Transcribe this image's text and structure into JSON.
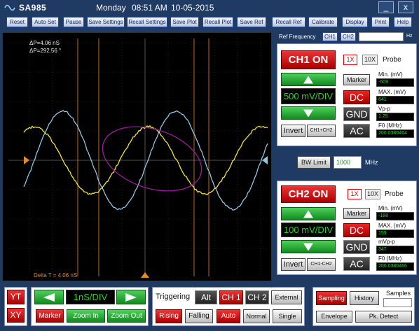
{
  "titlebar": {
    "app_name": "SA985",
    "day": "Monday",
    "time": "08:51 AM",
    "date": "10-05-2015",
    "minimize": "_",
    "close": "x"
  },
  "toolbar": {
    "buttons": [
      "Reset",
      "Auto Set",
      "Pause",
      "Save Settings",
      "Recall Settings",
      "Save Plot",
      "Recall Plot",
      "Save Ref",
      "Recall Ref",
      "Calibrate",
      "Display",
      "Print",
      "Help"
    ]
  },
  "scope": {
    "delta_p1": "ΔP=4.06  nS",
    "delta_p2": "ΔP=292.56 °",
    "delta_t": "Delta T = 4.06 nS",
    "colors": {
      "ch1": "#f5e23a",
      "ch2": "#8fc7e8",
      "xy": "#9b1c9b",
      "cursor": "#e08a2c",
      "grid": "#3a3a3a"
    }
  },
  "ref": {
    "label": "Ref Frequency",
    "ch1": "CH1",
    "ch2": "CH2",
    "value": "",
    "unit": "Hz"
  },
  "ch1": {
    "on_label": "CH1 ON",
    "x1": "1X",
    "x10": "10X",
    "probe": "Probe",
    "volt_div": "500 mV/DIV",
    "dc": "DC",
    "gnd": "GND",
    "ac": "AC",
    "invert": "Invert",
    "math": "CH1+CH2",
    "marker": "Marker",
    "min_label": "Min. (mV)",
    "min_val": "-609",
    "max_label": "MAX. (mV)",
    "max_val": "641",
    "vpp_label": "Vp-p",
    "vpp_val": "1.25",
    "f0_label": "F0 (MHz)",
    "f0_val": "200.0380464"
  },
  "bw": {
    "label": "BW Limit",
    "value": "1000",
    "unit": "MHz"
  },
  "ch2": {
    "on_label": "CH2 ON",
    "x1": "1X",
    "x10": "10X",
    "probe": "Probe",
    "volt_div": "100 mV/DIV",
    "dc": "DC",
    "gnd": "GND",
    "ac": "AC",
    "invert": "Invert",
    "math": "CH1-CH2",
    "marker": "Marker",
    "min_label": "Min. (mV)",
    "min_val": "-188",
    "max_label": "MAX. (mV)",
    "max_val": "159",
    "vpp_label": "mVp-p",
    "vpp_val": "347",
    "f0_label": "F0 (MHz)",
    "f0_val": "200.0380466"
  },
  "bottom": {
    "yt": "YT",
    "xy": "XY",
    "timebase": "1nS/DIV",
    "marker": "Marker",
    "zoom_in": "Zoom In",
    "zoom_out": "Zoom Out",
    "triggering": "Triggering",
    "alt": "Alt",
    "trig_ch1": "CH 1",
    "trig_ch2": "CH 2",
    "external": "External",
    "rising": "Rising",
    "falling": "Falling",
    "auto": "Auto",
    "normal": "Normal",
    "single": "Single",
    "sampling": "Sampling",
    "history": "History",
    "samples": "Samples",
    "envelope": "Envelope",
    "pk_detect": "Pk. Detect"
  }
}
